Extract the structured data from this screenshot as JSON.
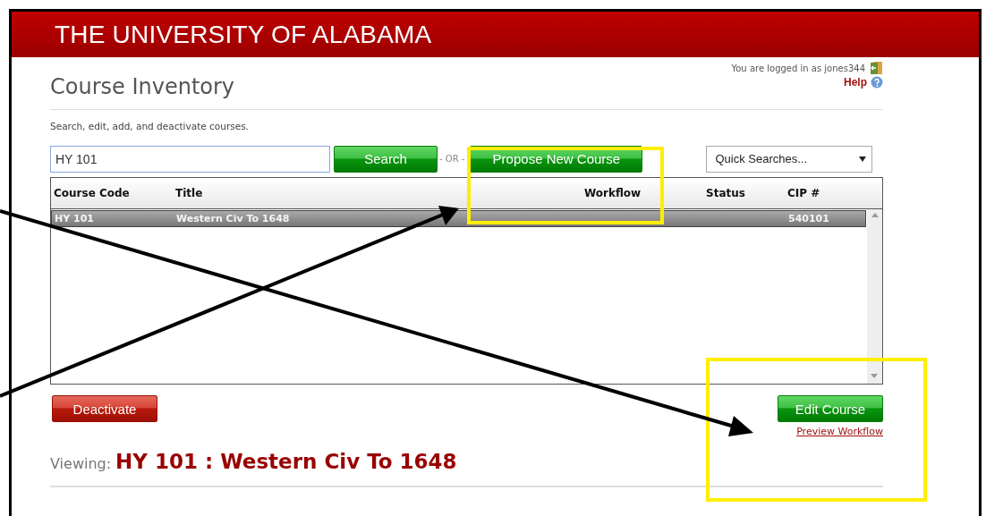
{
  "header": {
    "title": "THE UNIVERSITY OF ALABAMA"
  },
  "user": {
    "login_text": "You are logged in as jones344",
    "help_link": "Help"
  },
  "page": {
    "title": "Course Inventory",
    "description": "Search, edit, add, and deactivate courses."
  },
  "search": {
    "value": "HY 101",
    "button": "Search",
    "separator": "- OR -",
    "propose_button": "Propose New Course",
    "quick_searches": "Quick Searches..."
  },
  "table": {
    "columns": [
      "Course Code",
      "Title",
      "Workflow",
      "Status",
      "CIP #"
    ],
    "rows": [
      {
        "course_code": "HY 101",
        "title": "Western Civ To 1648",
        "cip": "540101",
        "selected": true
      }
    ]
  },
  "actions": {
    "deactivate": "Deactivate",
    "edit": "Edit Course",
    "preview_link": "Preview Workflow"
  },
  "viewing": {
    "label": "Viewing:",
    "course": "HY 101 : Western Civ To 1648"
  }
}
